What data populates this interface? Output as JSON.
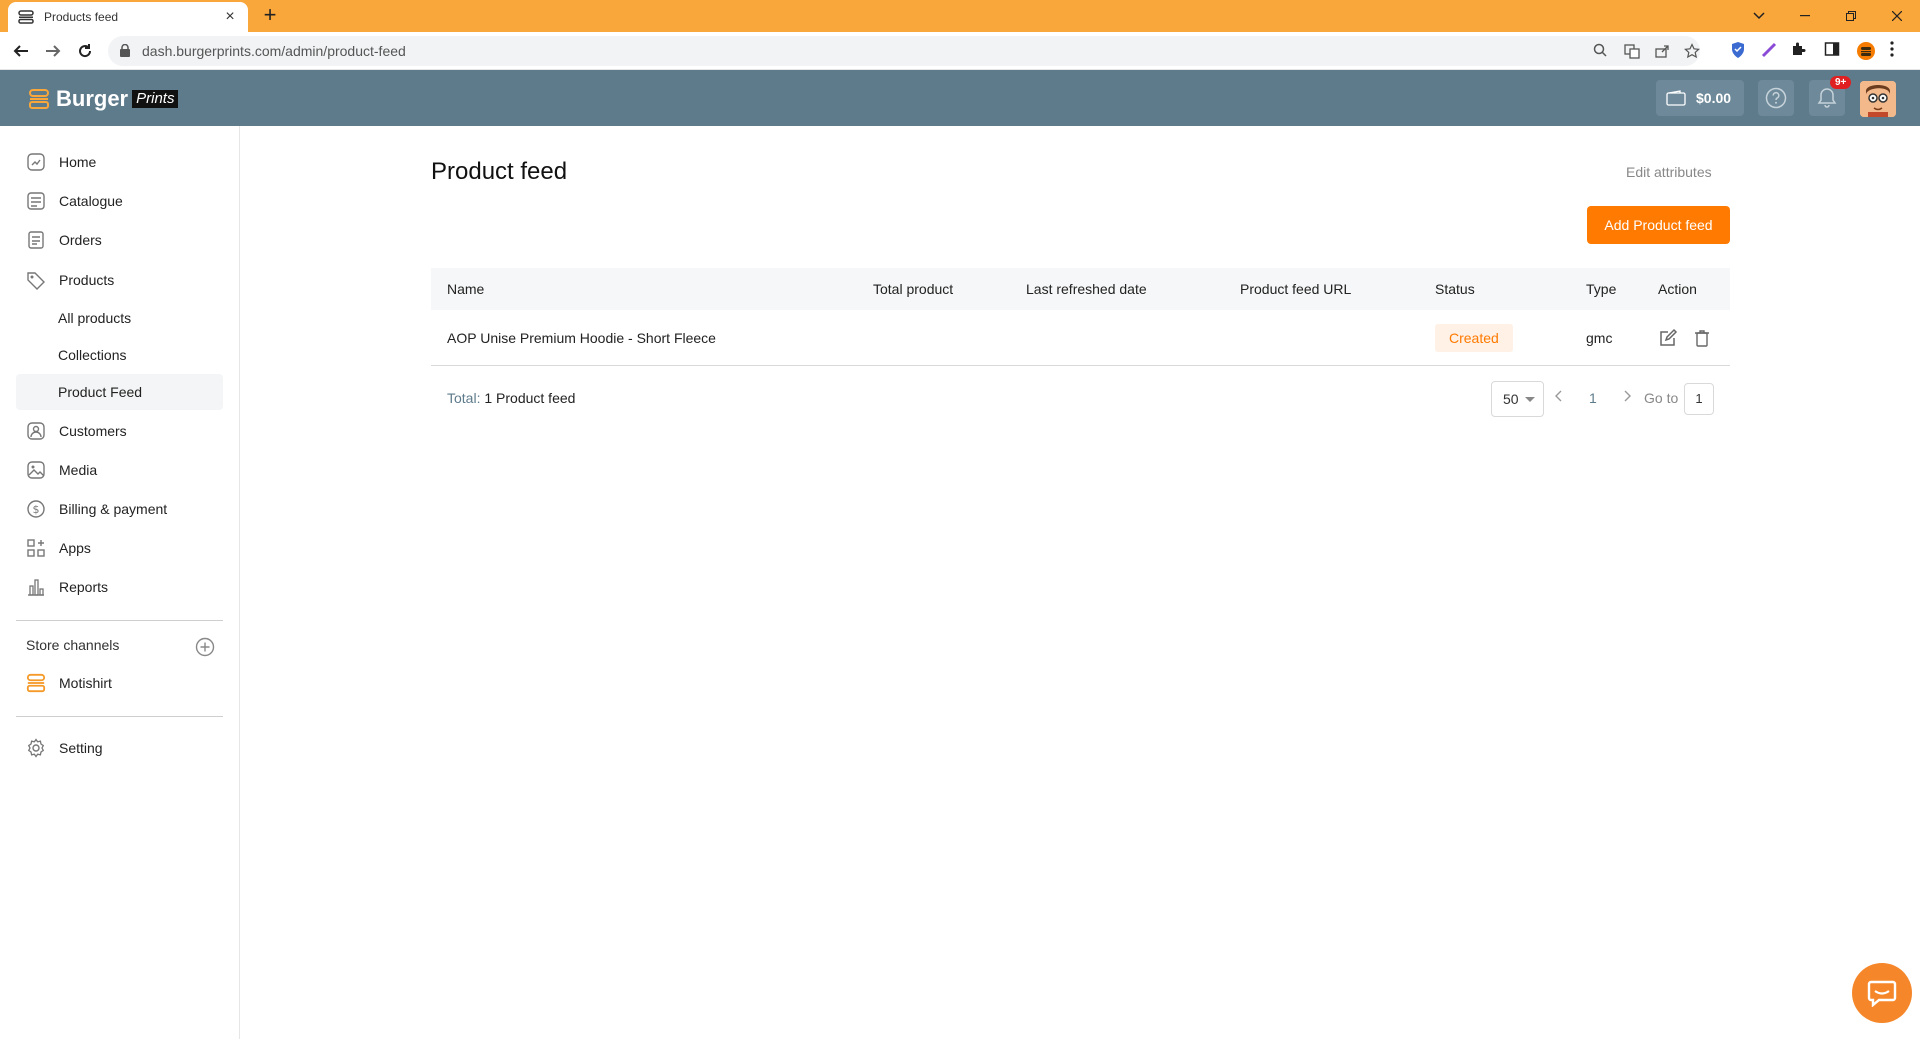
{
  "browser": {
    "tab_title": "Products feed",
    "url": "dash.burgerprints.com/admin/product-feed"
  },
  "header": {
    "logo_main": "Burger",
    "logo_sub": "Prints",
    "wallet_amount": "$0.00",
    "notification_badge": "9+"
  },
  "sidebar": {
    "items": [
      {
        "label": "Home",
        "icon": "home-icon"
      },
      {
        "label": "Catalogue",
        "icon": "catalogue-icon"
      },
      {
        "label": "Orders",
        "icon": "orders-icon"
      },
      {
        "label": "Products",
        "icon": "products-icon"
      }
    ],
    "sub_items": [
      {
        "label": "All products"
      },
      {
        "label": "Collections"
      },
      {
        "label": "Product Feed",
        "active": true
      }
    ],
    "items2": [
      {
        "label": "Customers",
        "icon": "customers-icon"
      },
      {
        "label": "Media",
        "icon": "media-icon"
      },
      {
        "label": "Billing & payment",
        "icon": "billing-icon"
      },
      {
        "label": "Apps",
        "icon": "apps-icon"
      },
      {
        "label": "Reports",
        "icon": "reports-icon"
      }
    ],
    "store_channels_label": "Store channels",
    "store_name": "Motishirt",
    "setting_label": "Setting"
  },
  "main": {
    "title": "Product feed",
    "edit_attributes": "Edit attributes",
    "add_button": "Add Product feed",
    "columns": [
      "Name",
      "Total product",
      "Last refreshed date",
      "Product feed URL",
      "Status",
      "Type",
      "Action"
    ],
    "rows": [
      {
        "name": "AOP Unise Premium Hoodie - Short Fleece",
        "total_product": "",
        "last_refreshed": "",
        "url": "",
        "status": "Created",
        "type": "gmc"
      }
    ],
    "total_label": "Total:",
    "total_value": "1 Product feed",
    "page_size": "50",
    "current_page": "1",
    "goto_label": "Go to",
    "goto_value": "1"
  },
  "colors": {
    "chrome_tab_bar": "#f9a63a",
    "app_header": "#5e7b8c",
    "accent": "#ff7a00"
  }
}
